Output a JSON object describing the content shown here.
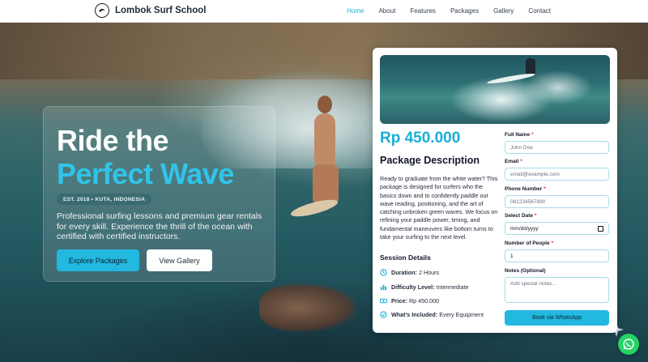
{
  "header": {
    "brand_name": "Lombok Surf School",
    "nav": [
      {
        "label": "Home",
        "active": true
      },
      {
        "label": "About",
        "active": false
      },
      {
        "label": "Features",
        "active": false
      },
      {
        "label": "Packages",
        "active": false
      },
      {
        "label": "Gallery",
        "active": false
      },
      {
        "label": "Contact",
        "active": false
      }
    ]
  },
  "hero": {
    "title_line1": "Ride the",
    "title_line2": "Perfect Wave",
    "badge": "EST. 2018 • KUTA, INDONESIA",
    "description": "Professional surfing lessons and premium gear rentals for every skill. Experience the thrill of the ocean with certified with certified instructors.",
    "primary_button": "Explore Packages",
    "secondary_button": "View Gallery"
  },
  "package": {
    "price": "Rp 450.000",
    "title": "Package Description",
    "description": "Ready to graduate from the white water? This package is designed for surfers who the basics down and to confidently paddle out wave reading, positioning, and the art of catching unbroken green waves. We focus on refining your paddle power, timing, and fundamental maneuvers like bottom turns to take your surfing to the next level.",
    "session_title": "Session Details",
    "session_items": [
      {
        "icon": "clock-icon",
        "label": "Duration:",
        "value": "2 Hours"
      },
      {
        "icon": "bar-chart-icon",
        "label": "Difficulty Level:",
        "value": "Intermediate"
      },
      {
        "icon": "money-icon",
        "label": "Price:",
        "value": "Rp 450.000"
      },
      {
        "icon": "check-circle-icon",
        "label": "What's Included:",
        "value": "Every Equipment"
      }
    ]
  },
  "form": {
    "full_name": {
      "label": "Full Name",
      "required": "*",
      "placeholder": "John Doe"
    },
    "email": {
      "label": "Email",
      "required": "*",
      "placeholder": "email@example.com"
    },
    "phone": {
      "label": "Phone Number",
      "required": "*",
      "placeholder": "081234567890"
    },
    "date": {
      "label": "Select Date",
      "required": "*",
      "placeholder": "mm/dd/yyyy"
    },
    "people": {
      "label": "Number of People",
      "required": "*",
      "value": "1"
    },
    "notes": {
      "label": "Notes (Optional)",
      "placeholder": "Add special notes..."
    },
    "submit": "Book via WhatsApp"
  },
  "colors": {
    "accent": "#22b8df",
    "price": "#1aaed6",
    "whatsapp": "#25d366"
  }
}
